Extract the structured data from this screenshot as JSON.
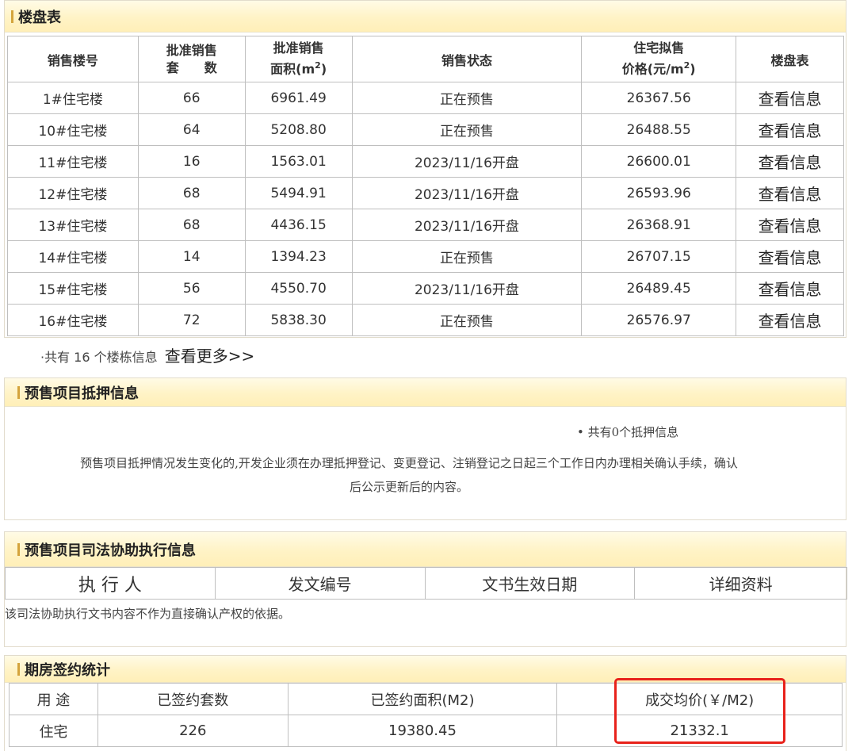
{
  "building_table": {
    "title": "楼盘表",
    "headers": {
      "building_no": "销售楼号",
      "units_line1": "批准销售",
      "units_line2": "套　　数",
      "area_line1": "批准销售",
      "area_line2": "面积(m",
      "area_sup": "2",
      "area_close": ")",
      "status": "销售状态",
      "price_line1": "住宅拟售",
      "price_line2": "价格(元/m",
      "price_sup": "2",
      "price_close": ")",
      "detail": "楼盘表"
    },
    "rows": [
      {
        "building": "1#住宅楼",
        "units": "66",
        "area": "6961.49",
        "status": "正在预售",
        "price": "26367.56",
        "link": "查看信息"
      },
      {
        "building": "10#住宅楼",
        "units": "64",
        "area": "5208.80",
        "status": "正在预售",
        "price": "26488.55",
        "link": "查看信息"
      },
      {
        "building": "11#住宅楼",
        "units": "16",
        "area": "1563.01",
        "status": "2023/11/16开盘",
        "price": "26600.01",
        "link": "查看信息"
      },
      {
        "building": "12#住宅楼",
        "units": "68",
        "area": "5494.91",
        "status": "2023/11/16开盘",
        "price": "26593.96",
        "link": "查看信息"
      },
      {
        "building": "13#住宅楼",
        "units": "68",
        "area": "4436.15",
        "status": "2023/11/16开盘",
        "price": "26368.91",
        "link": "查看信息"
      },
      {
        "building": "14#住宅楼",
        "units": "14",
        "area": "1394.23",
        "status": "正在预售",
        "price": "26707.15",
        "link": "查看信息"
      },
      {
        "building": "15#住宅楼",
        "units": "56",
        "area": "4550.70",
        "status": "2023/11/16开盘",
        "price": "26489.45",
        "link": "查看信息"
      },
      {
        "building": "16#住宅楼",
        "units": "72",
        "area": "5838.30",
        "status": "正在预售",
        "price": "26576.97",
        "link": "查看信息"
      }
    ],
    "footer_text": "·共有 16 个楼栋信息",
    "more_link": "查看更多>>"
  },
  "mortgage": {
    "title": "预售项目抵押信息",
    "count_text": "• 共有0个抵押信息",
    "notice_line1": "预售项目抵押情况发生变化的,开发企业须在办理抵押登记、变更登记、注销登记之日起三个工作日内办理相关确认手续，确认",
    "notice_line2": "后公示更新后的内容。"
  },
  "judicial": {
    "title": "预售项目司法协助执行信息",
    "headers": [
      "执 行 人",
      "发文编号",
      "文书生效日期",
      "详细资料"
    ],
    "note": "该司法协助执行文书内容不作为直接确认产权的依据。"
  },
  "contract_stats": {
    "title": "期房签约统计",
    "headers": [
      "用 途",
      "已签约套数",
      "已签约面积(M2)",
      "成交均价(￥/M2)"
    ],
    "rows": [
      {
        "use": "住宅",
        "units": "226",
        "area": "19380.45",
        "avg_price": "21332.1"
      }
    ]
  }
}
